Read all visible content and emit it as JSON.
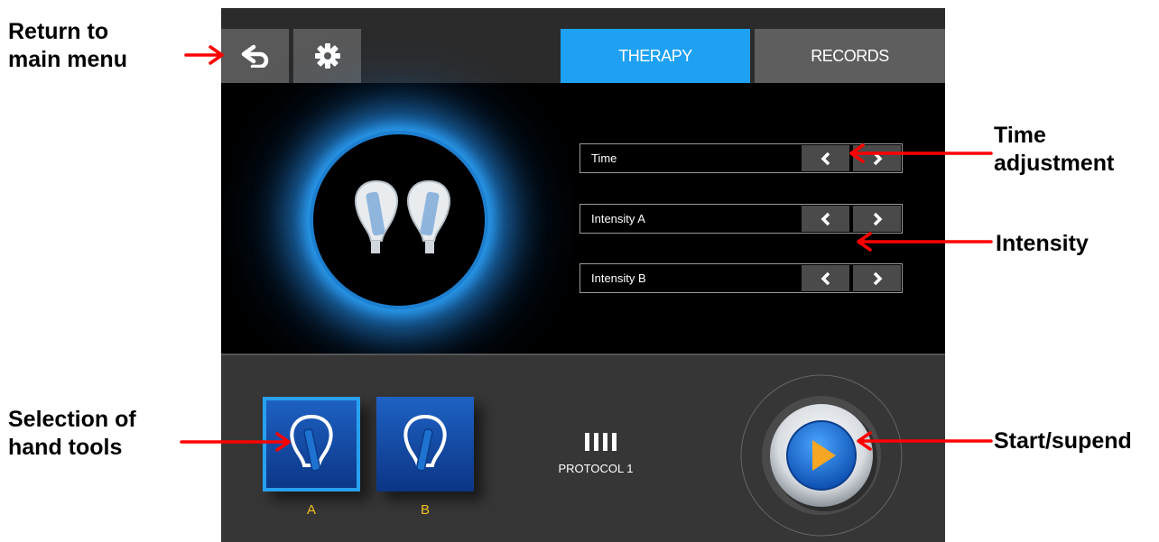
{
  "annotations": {
    "return_to_main_menu": "Return to\nmain menu",
    "time_adjustment": "Time\nadjustment",
    "intensity": "Intensity",
    "selection_of_hand_tools": "Selection of\nhand tools",
    "start_suspend": "Start/supend"
  },
  "topbar": {
    "back_icon": "back-arrow-icon",
    "settings_icon": "gear-icon",
    "tabs": [
      {
        "label": "THERAPY",
        "active": true
      },
      {
        "label": "RECORDS",
        "active": false
      }
    ]
  },
  "controls": [
    {
      "label": "Time"
    },
    {
      "label": "Intensity A"
    },
    {
      "label": "Intensity B"
    }
  ],
  "hand_tools": [
    {
      "label": "A",
      "selected": true
    },
    {
      "label": "B",
      "selected": false
    }
  ],
  "protocol": {
    "label": "PROTOCOL 1"
  },
  "colors": {
    "accent": "#1ea1f2",
    "annotation_arrow": "#ff0000",
    "tool_label": "#f0c020",
    "play_button": "#1e73c8"
  }
}
